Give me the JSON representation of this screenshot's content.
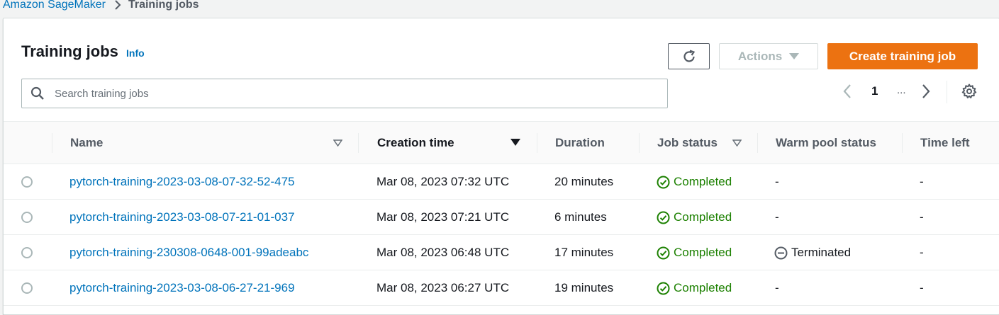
{
  "breadcrumb": {
    "root": "Amazon SageMaker",
    "current": "Training jobs"
  },
  "header": {
    "title": "Training jobs",
    "info": "Info",
    "actions_label": "Actions",
    "create_label": "Create training job"
  },
  "search": {
    "placeholder": "Search training jobs",
    "value": ""
  },
  "pagination": {
    "current_page": "1",
    "ellipsis": "..."
  },
  "table": {
    "columns": [
      {
        "label": "Name",
        "filterable": true
      },
      {
        "label": "Creation time",
        "sorted": "descending"
      },
      {
        "label": "Duration"
      },
      {
        "label": "Job status",
        "filterable": true
      },
      {
        "label": "Warm pool status"
      },
      {
        "label": "Time left"
      }
    ],
    "rows": [
      {
        "name": "pytorch-training-2023-03-08-07-32-52-475",
        "created": "Mar 08, 2023 07:32 UTC",
        "duration": "20 minutes",
        "status": "Completed",
        "warm_pool": "-",
        "time_left": "-"
      },
      {
        "name": "pytorch-training-2023-03-08-07-21-01-037",
        "created": "Mar 08, 2023 07:21 UTC",
        "duration": "6 minutes",
        "status": "Completed",
        "warm_pool": "-",
        "time_left": "-"
      },
      {
        "name": "pytorch-training-230308-0648-001-99adeabc",
        "created": "Mar 08, 2023 06:48 UTC",
        "duration": "17 minutes",
        "status": "Completed",
        "warm_pool": "Terminated",
        "time_left": "-"
      },
      {
        "name": "pytorch-training-2023-03-08-06-27-21-969",
        "created": "Mar 08, 2023 06:27 UTC",
        "duration": "19 minutes",
        "status": "Completed",
        "warm_pool": "-",
        "time_left": "-"
      }
    ]
  },
  "icons": {
    "refresh": "refresh-icon",
    "actions_caret": "caret-down-icon",
    "search": "search-icon",
    "prev": "chevron-left-icon",
    "next": "chevron-right-icon",
    "settings": "gear-icon",
    "status_ok": "check-circle-icon",
    "warm_pool_terminated": "minus-circle-icon"
  },
  "colors": {
    "link": "#0073bb",
    "primary_button": "#ec7211",
    "success": "#1d8102"
  }
}
